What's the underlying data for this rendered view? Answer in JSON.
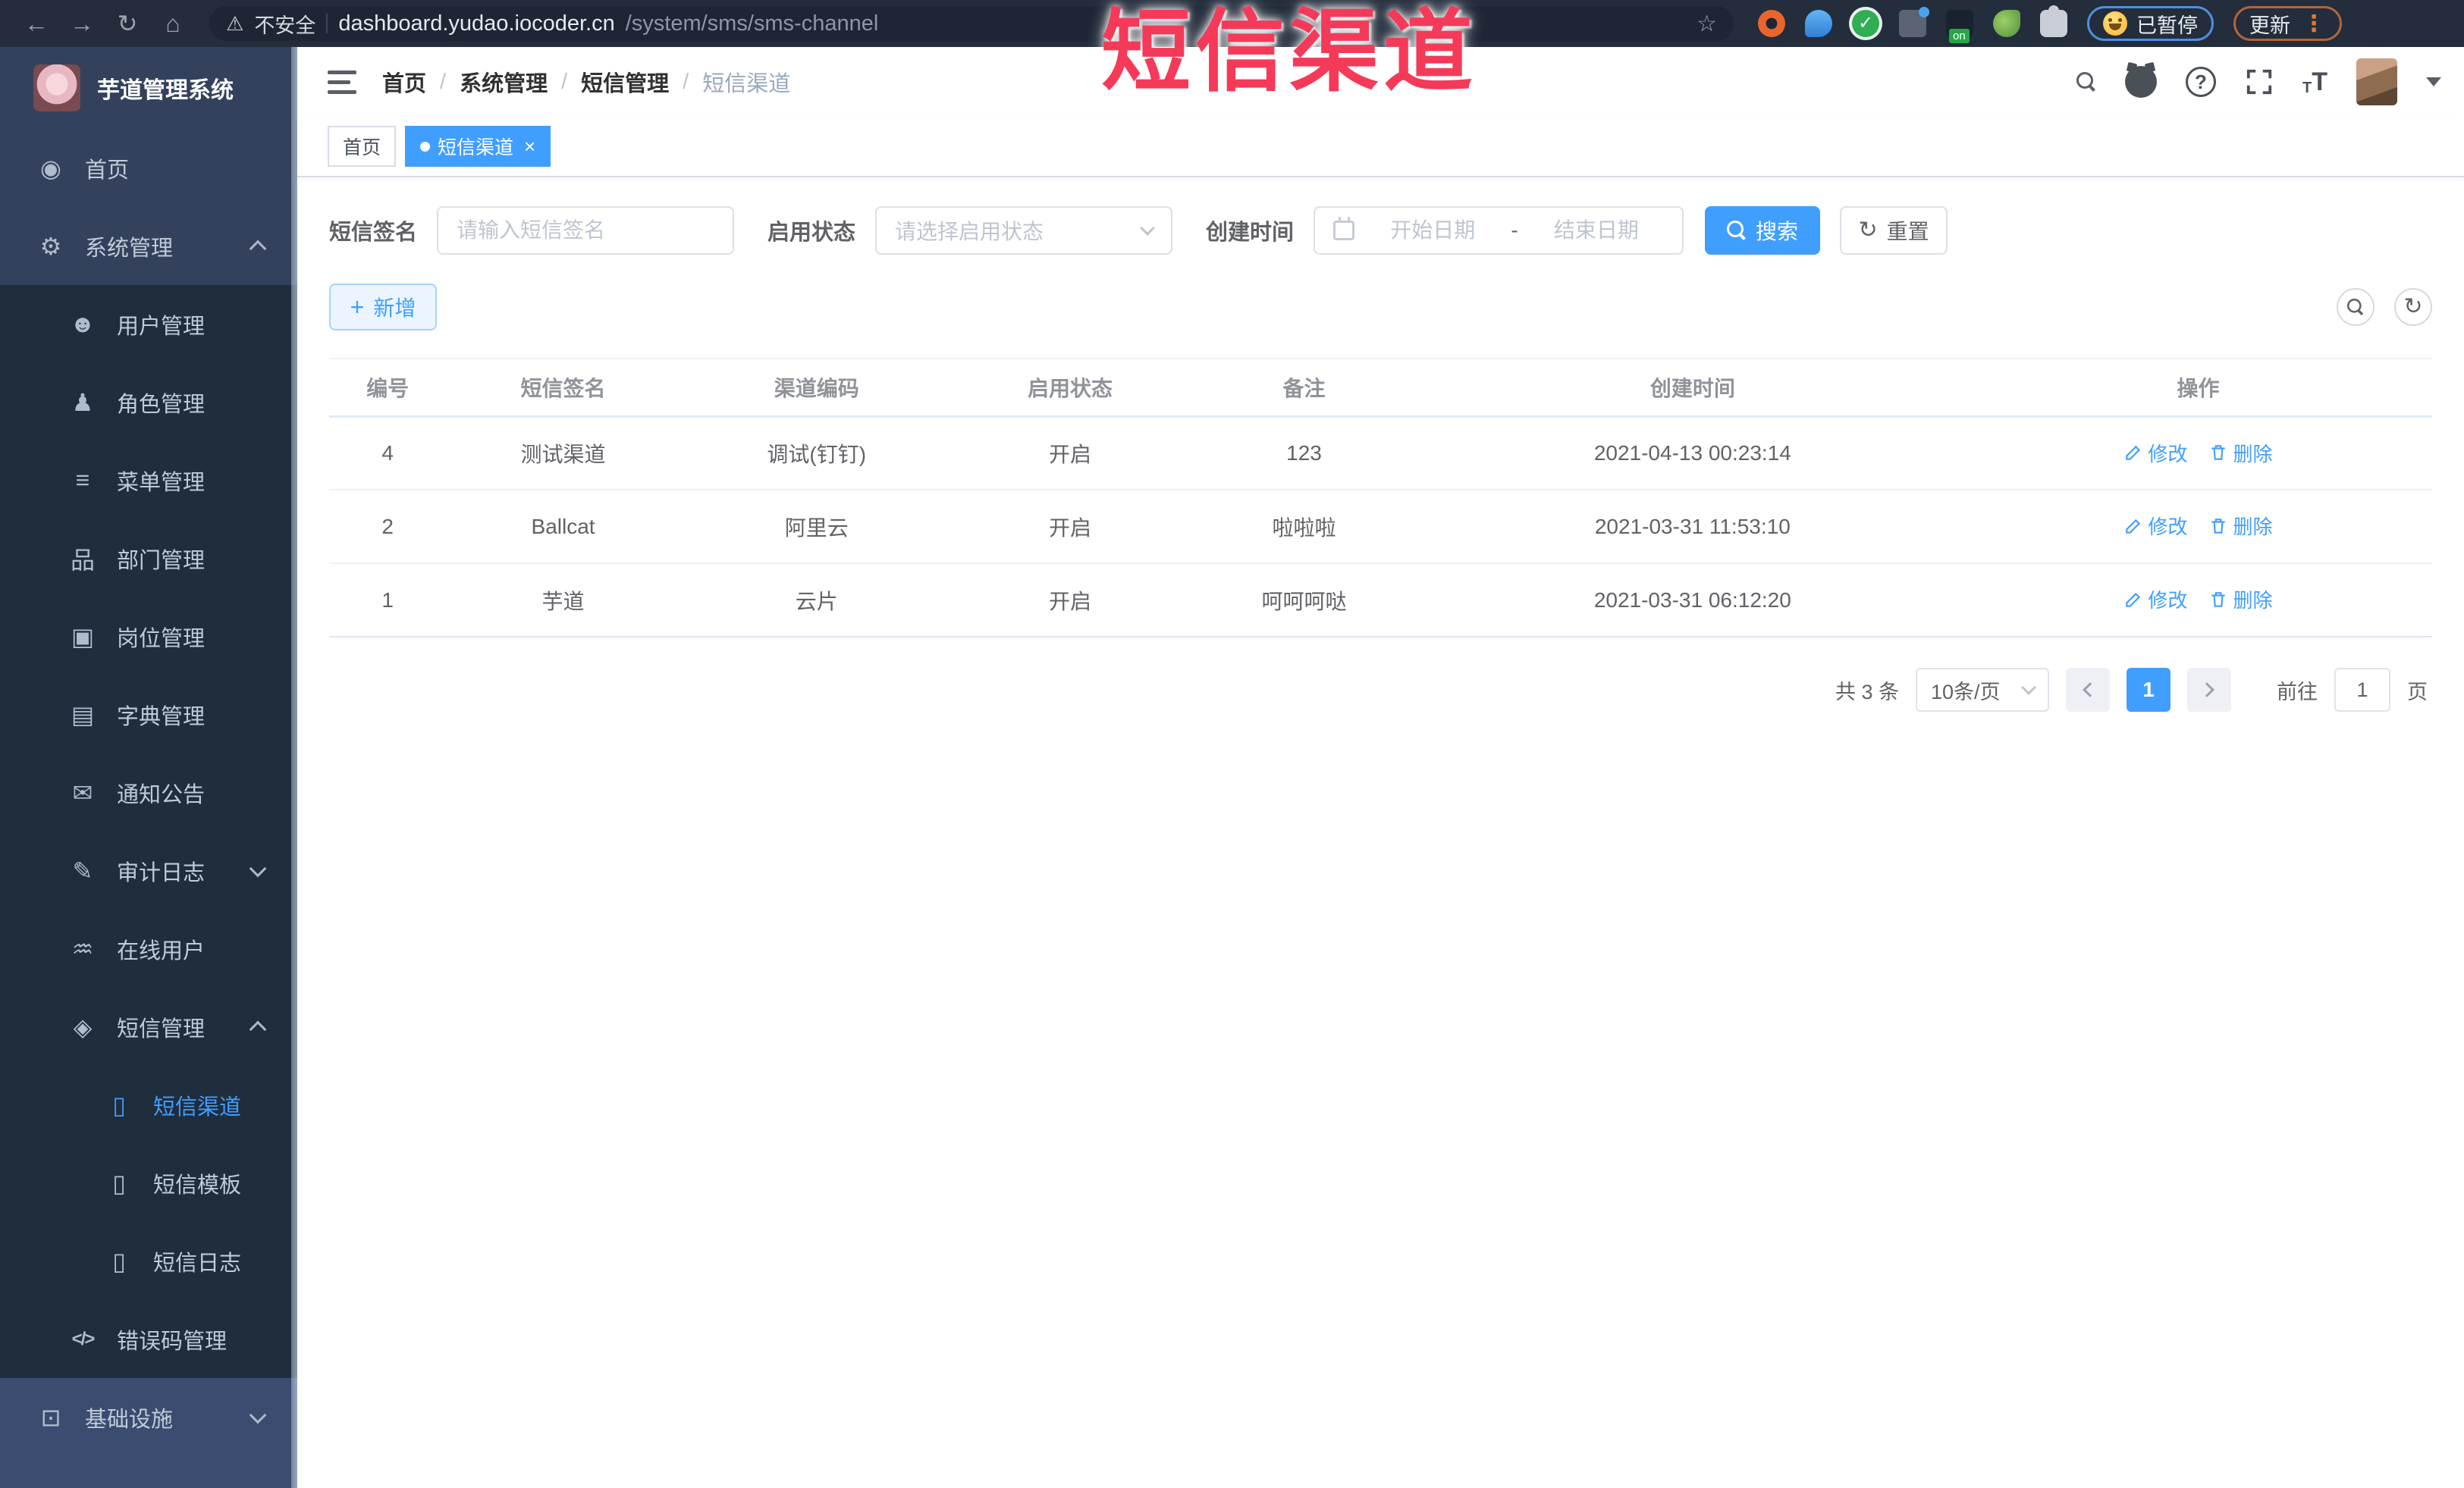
{
  "browser": {
    "security_label": "不安全",
    "url_host": "dashboard.yudao.iocoder.cn",
    "url_path": "/system/sms/sms-channel",
    "paused_label": "已暂停",
    "update_label": "更新"
  },
  "overlay": {
    "title": "短信渠道",
    "color": "#f43a58"
  },
  "sidebar": {
    "logo_title": "芋道管理系统",
    "items": [
      {
        "key": "home",
        "label": "首页",
        "icon": "dashboard-icon",
        "level": 1,
        "zone": "top"
      },
      {
        "key": "system",
        "label": "系统管理",
        "icon": "gear-icon",
        "level": 1,
        "zone": "top",
        "chevron": "up"
      },
      {
        "key": "user",
        "label": "用户管理",
        "icon": "user-icon",
        "level": 2,
        "zone": "sub"
      },
      {
        "key": "role",
        "label": "角色管理",
        "icon": "users-icon",
        "level": 2,
        "zone": "sub"
      },
      {
        "key": "menu",
        "label": "菜单管理",
        "icon": "menu-list-icon",
        "level": 2,
        "zone": "sub"
      },
      {
        "key": "dept",
        "label": "部门管理",
        "icon": "org-tree-icon",
        "level": 2,
        "zone": "sub"
      },
      {
        "key": "post",
        "label": "岗位管理",
        "icon": "badge-icon",
        "level": 2,
        "zone": "sub"
      },
      {
        "key": "dict",
        "label": "字典管理",
        "icon": "dictionary-icon",
        "level": 2,
        "zone": "sub"
      },
      {
        "key": "notice",
        "label": "通知公告",
        "icon": "announcement-icon",
        "level": 2,
        "zone": "sub"
      },
      {
        "key": "audit-log",
        "label": "审计日志",
        "icon": "audit-log-icon",
        "level": 2,
        "zone": "sub",
        "chevron": "down"
      },
      {
        "key": "online-user",
        "label": "在线用户",
        "icon": "online-users-icon",
        "level": 2,
        "zone": "sub"
      },
      {
        "key": "sms",
        "label": "短信管理",
        "icon": "sms-shield-icon",
        "level": 2,
        "zone": "sub",
        "chevron": "up"
      },
      {
        "key": "sms-channel",
        "label": "短信渠道",
        "icon": "phone-icon",
        "level": 3,
        "zone": "sub",
        "active": true
      },
      {
        "key": "sms-template",
        "label": "短信模板",
        "icon": "phone-icon",
        "level": 3,
        "zone": "sub"
      },
      {
        "key": "sms-log",
        "label": "短信日志",
        "icon": "phone-icon",
        "level": 3,
        "zone": "sub"
      },
      {
        "key": "error-code",
        "label": "错误码管理",
        "icon": "code-icon",
        "level": 2,
        "zone": "sub"
      },
      {
        "key": "infra",
        "label": "基础设施",
        "icon": "infra-icon",
        "level": 1,
        "zone": "bottom",
        "chevron": "down"
      }
    ]
  },
  "icon_glyphs": {
    "dashboard-icon": "◉",
    "gear-icon": "⚙",
    "user-icon": "☻",
    "users-icon": "♟",
    "menu-list-icon": "≡",
    "org-tree-icon": "品",
    "badge-icon": "▣",
    "dictionary-icon": "▤",
    "announcement-icon": "✉",
    "audit-log-icon": "✎",
    "online-users-icon": "♒",
    "sms-shield-icon": "◈",
    "phone-icon": "▯",
    "code-icon": "</>",
    "infra-icon": "⊡"
  },
  "header": {
    "breadcrumb": [
      "首页",
      "系统管理",
      "短信管理",
      "短信渠道"
    ]
  },
  "tabs": [
    {
      "label": "首页",
      "active": false,
      "closable": false
    },
    {
      "label": "短信渠道",
      "active": true,
      "closable": true
    }
  ],
  "filters": {
    "sign_label": "短信签名",
    "sign_placeholder": "请输入短信签名",
    "status_label": "启用状态",
    "status_placeholder": "请选择启用状态",
    "time_label": "创建时间",
    "start_placeholder": "开始日期",
    "range_separator": "-",
    "end_placeholder": "结束日期",
    "search_label": "搜索",
    "reset_label": "重置"
  },
  "toolbar": {
    "add_label": "新增"
  },
  "table": {
    "columns": [
      "编号",
      "短信签名",
      "渠道编码",
      "启用状态",
      "备注",
      "创建时间",
      "操作"
    ],
    "row_keys": [
      "id",
      "sign",
      "code",
      "status",
      "remark",
      "created"
    ],
    "rows": [
      {
        "id": "4",
        "sign": "测试渠道",
        "code": "调试(钉钉)",
        "status": "开启",
        "remark": "123",
        "created": "2021-04-13 00:23:14"
      },
      {
        "id": "2",
        "sign": "Ballcat",
        "code": "阿里云",
        "status": "开启",
        "remark": "啦啦啦",
        "created": "2021-03-31 11:53:10"
      },
      {
        "id": "1",
        "sign": "芋道",
        "code": "云片",
        "status": "开启",
        "remark": "呵呵呵哒",
        "created": "2021-03-31 06:12:20"
      }
    ],
    "edit_label": "修改",
    "delete_label": "删除"
  },
  "pagination": {
    "total_text": "共 3 条",
    "page_size": "10条/页",
    "current_page": "1",
    "goto_label": "前往",
    "goto_value": "1",
    "page_suffix": "页"
  },
  "colors": {
    "accent": "#409EFF",
    "sidebar_bg": "#33415c",
    "submenu_bg": "#1f2d3d",
    "overlay_red": "#f43a58"
  }
}
